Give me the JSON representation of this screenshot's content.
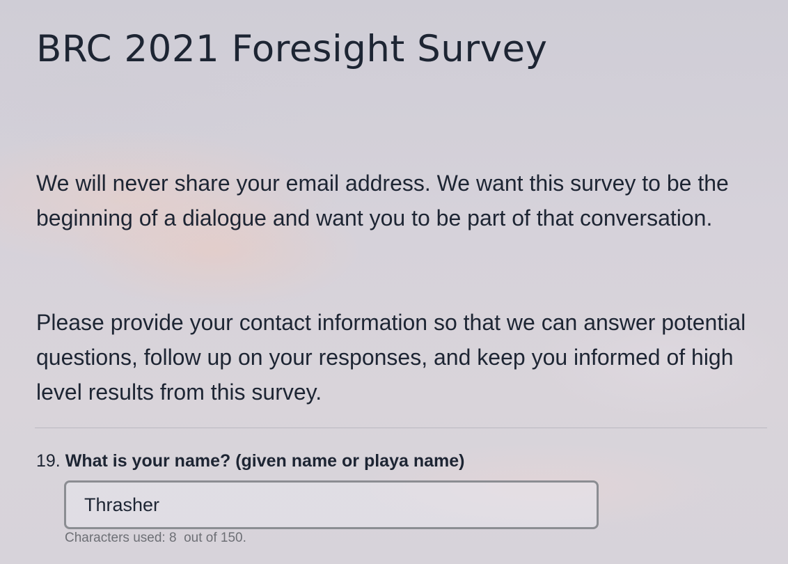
{
  "page": {
    "title": "BRC 2021 Foresight Survey"
  },
  "intro": {
    "paragraph1": "We will never share your email address. We want this survey to be the beginning of a dialogue and want you to be part of that conversation.",
    "paragraph2": "Please provide your contact information so that we can answer potential questions, follow up on your responses, and keep you informed of high level results from this survey."
  },
  "question": {
    "number": "19.",
    "text": "What is your name? (given name or playa name)",
    "value": "Thrasher",
    "counter_prefix": "Characters used: ",
    "counter_used": "8",
    "counter_suffix": "  out of 150."
  }
}
